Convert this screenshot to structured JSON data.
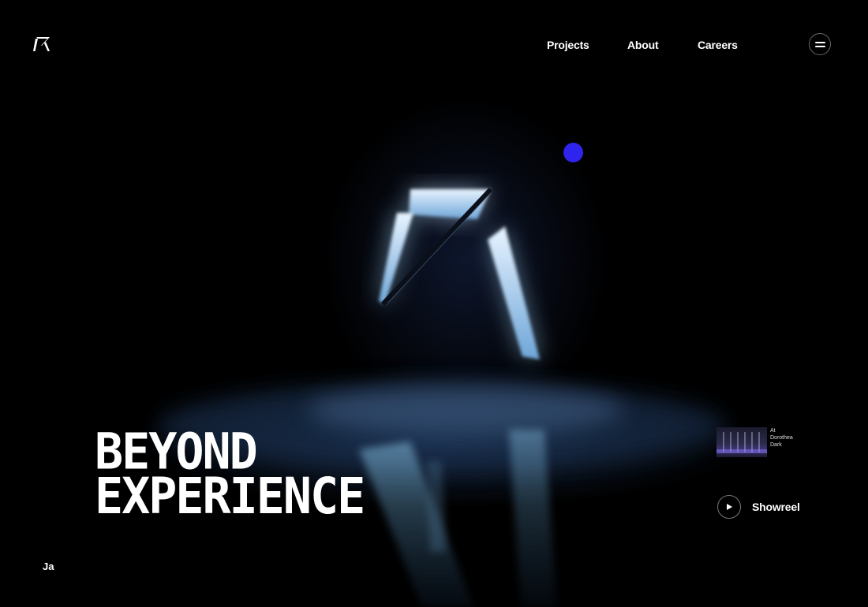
{
  "header": {
    "logo_icon": "brand-logo-icon",
    "nav": [
      {
        "label": "Projects"
      },
      {
        "label": "About"
      },
      {
        "label": "Careers"
      }
    ],
    "menu_icon": "hamburger-menu-icon"
  },
  "hero": {
    "line1": "BEYOND",
    "line2": "EXPERIENCE"
  },
  "corner_text": "Ja",
  "preview": {
    "label_line1": "At",
    "label_line2": "Dorothea",
    "label_line3": "Dark"
  },
  "showreel": {
    "label": "Showreel",
    "icon": "play-icon"
  },
  "colors": {
    "background": "#000000",
    "accent": "#2e24ee",
    "text": "#ffffff"
  }
}
